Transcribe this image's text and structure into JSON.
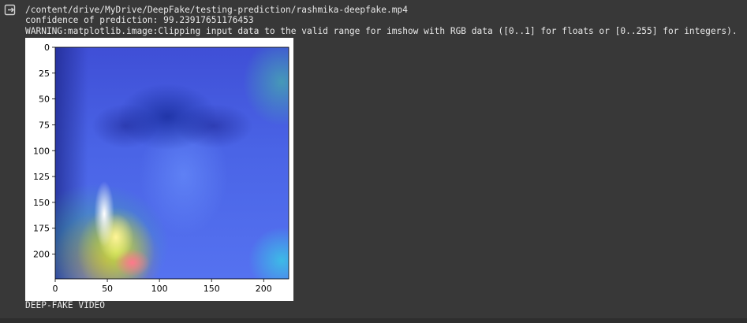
{
  "output": {
    "path_line": "/content/drive/MyDrive/DeepFake/testing-prediction/rashmika-deepfake.mp4",
    "confidence_line": "confidence of prediction: 99.23917651176453",
    "warning_line": "WARNING:matplotlib.image:Clipping input data to the valid range for imshow with RGB data ([0..1] for floats or [0..255] for integers).",
    "result_line": "DEEP-FAKE VIDEO",
    "icon": "output-exit-icon"
  },
  "chart_data": {
    "type": "heatmap",
    "title": "",
    "xlabel": "",
    "ylabel": "",
    "xlim": [
      0,
      224
    ],
    "ylim": [
      224,
      0
    ],
    "xticks": [
      0,
      50,
      100,
      150,
      200
    ],
    "yticks": [
      0,
      25,
      50,
      75,
      100,
      125,
      150,
      175,
      200
    ],
    "grid": false,
    "colormap": "jet"
  },
  "colors": {
    "background": "#383838",
    "text": "#e8e8e8",
    "plot_panel": "#ffffff"
  }
}
